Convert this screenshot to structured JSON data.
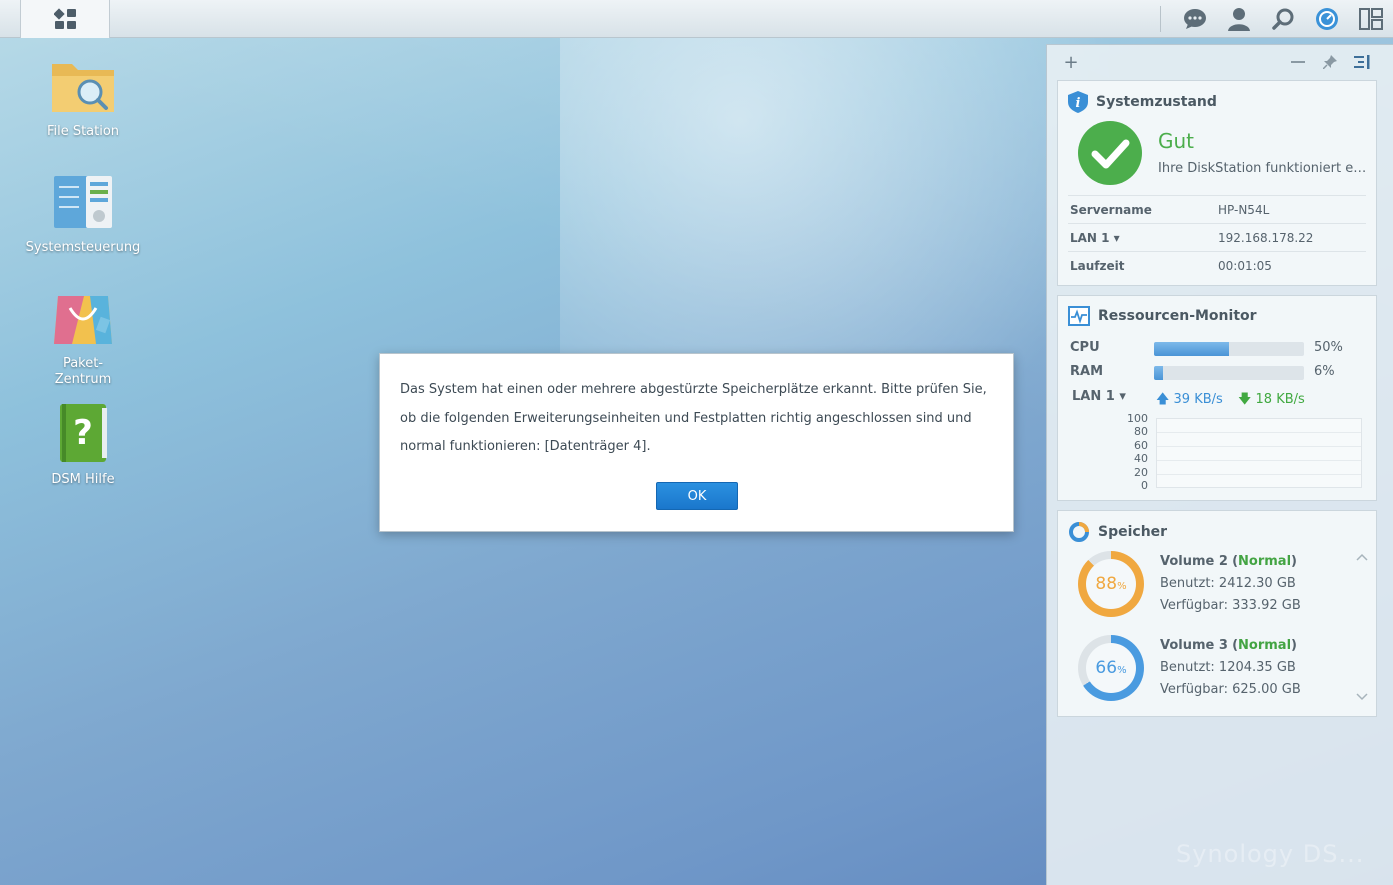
{
  "desktop": {
    "icons": [
      {
        "label": "File Station"
      },
      {
        "label": "Systemsteuerung"
      },
      {
        "label": "Paket-\nZentrum"
      },
      {
        "label": "DSM Hilfe"
      }
    ]
  },
  "dialog": {
    "message": "Das System hat einen oder mehrere abgestürzte Speicherplätze erkannt. Bitte prüfen Sie, ob die folgenden Erweiterungseinheiten und Festplatten richtig angeschlossen sind und normal funktionieren: [Datenträger 4].",
    "ok_label": "OK"
  },
  "widgets": {
    "add_label": "+",
    "system_health": {
      "title": "Systemzustand",
      "status": "Gut",
      "description": "Ihre DiskStation funktioniert einwandfrei.",
      "rows": [
        {
          "key": "Servername",
          "value": "HP-N54L"
        },
        {
          "key": "LAN 1 ▾",
          "value": "192.168.178.22"
        },
        {
          "key": "Laufzeit",
          "value": "00:01:05"
        }
      ]
    },
    "resource_monitor": {
      "title": "Ressourcen-Monitor",
      "cpu_label": "CPU",
      "cpu_percent": 50,
      "cpu_text": "50%",
      "ram_label": "RAM",
      "ram_percent": 6,
      "ram_text": "6%",
      "lan_label": "LAN 1 ▾",
      "upload": "39 KB/s",
      "download": "18 KB/s",
      "chart_ticks": [
        "100",
        "80",
        "60",
        "40",
        "20",
        "0"
      ]
    },
    "storage": {
      "title": "Speicher",
      "volumes": [
        {
          "name": "Volume 2",
          "status": "Normal",
          "percent": 88,
          "used": "Benutzt: 2412.30 GB",
          "free": "Verfügbar: 333.92 GB",
          "color": "#f0a840"
        },
        {
          "name": "Volume 3",
          "status": "Normal",
          "percent": 66,
          "used": "Benutzt: 1204.35 GB",
          "free": "Verfügbar: 625.00 GB",
          "color": "#4a9be0"
        }
      ]
    },
    "watermark": "Synology DS..."
  },
  "colors": {
    "ok_green": "#4cae4c",
    "accent_blue": "#1a77cc"
  }
}
